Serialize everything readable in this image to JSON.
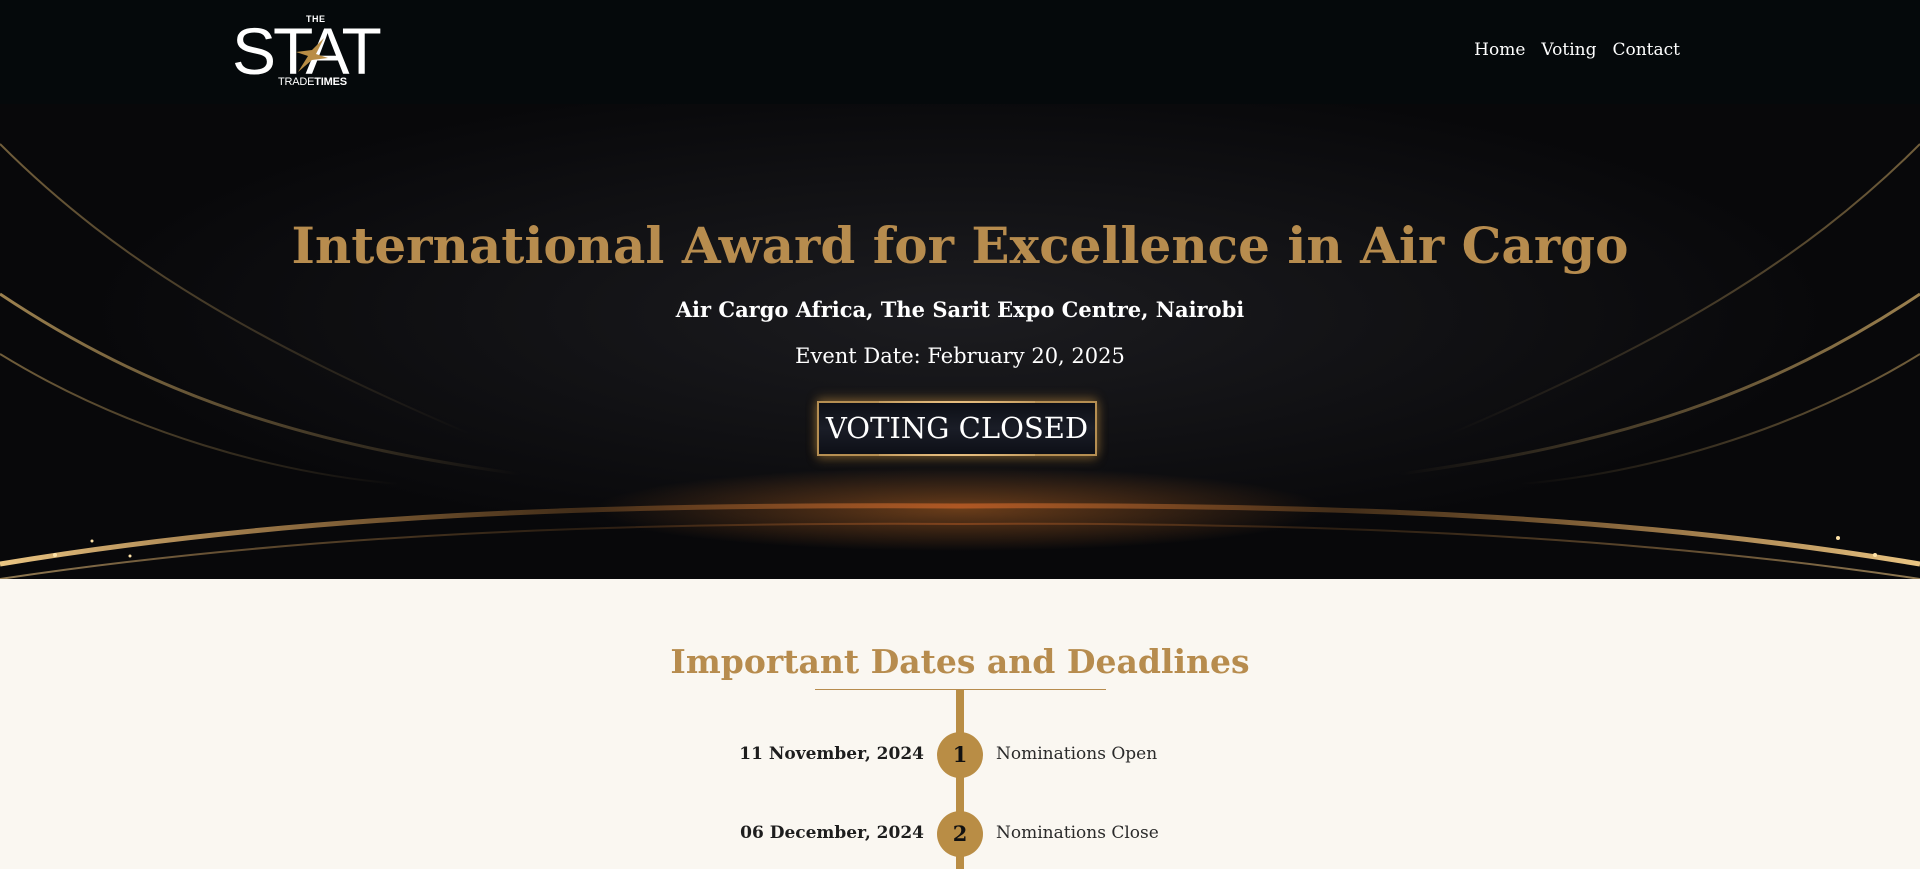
{
  "header": {
    "logo": {
      "the": "THE",
      "stat": "STAT",
      "trade": "TRADE",
      "times": "TIMES"
    },
    "nav": [
      {
        "label": "Home"
      },
      {
        "label": "Voting"
      },
      {
        "label": "Contact"
      }
    ]
  },
  "hero": {
    "title": "International Award for Excellence in Air Cargo",
    "subtitle": "Air Cargo Africa, The Sarit Expo Centre, Nairobi",
    "event_date": "Event Date: February 20, 2025",
    "voting_status": "VOTING CLOSED"
  },
  "dates": {
    "title": "Important Dates and Deadlines",
    "items": [
      {
        "date": "11 November, 2024",
        "number": "1",
        "label": "Nominations Open"
      },
      {
        "date": "06 December, 2024",
        "number": "2",
        "label": "Nominations Close"
      }
    ]
  },
  "colors": {
    "gold": "#b78c4e",
    "header_bg": "#05090b",
    "page_bg": "#faf7f1"
  }
}
